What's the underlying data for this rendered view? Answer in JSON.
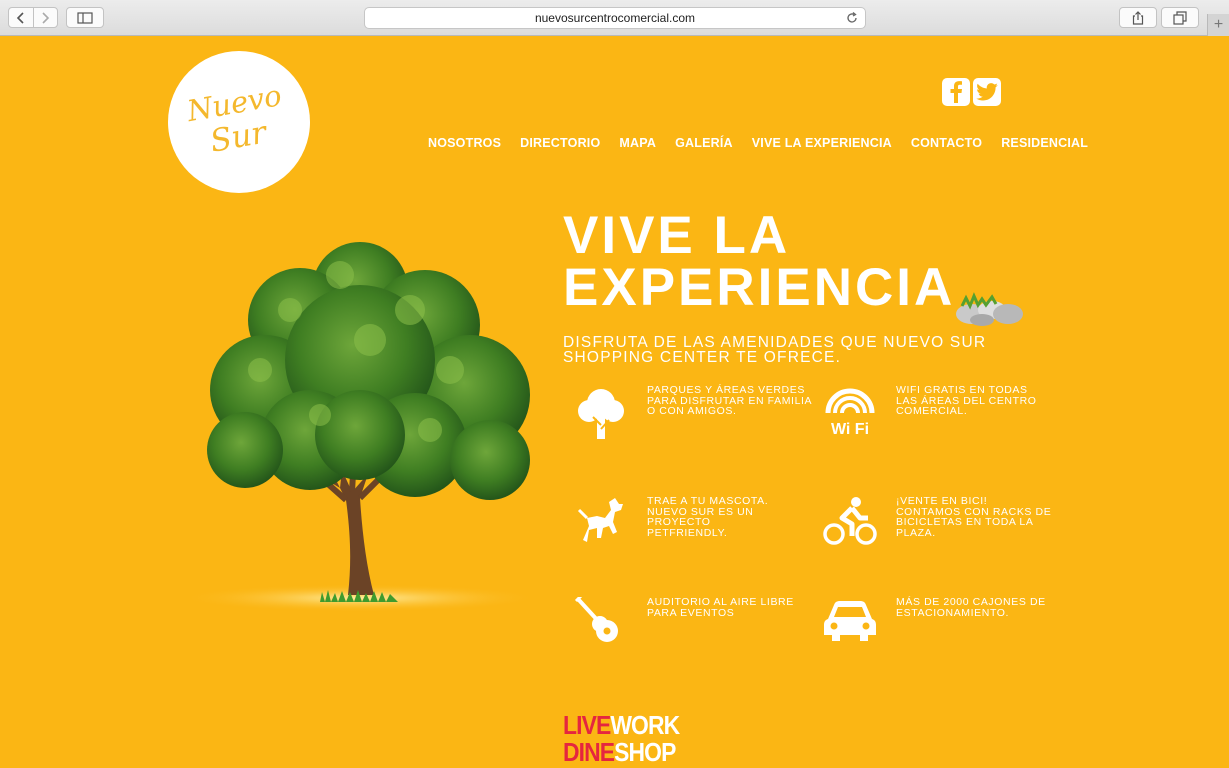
{
  "browser": {
    "url": "nuevosurcentrocomercial.com",
    "newtab_label": "+"
  },
  "brand": {
    "logo_line1": "Nuevo",
    "logo_line2": "Sur"
  },
  "social": [
    "facebook-icon",
    "twitter-icon"
  ],
  "nav": [
    {
      "label": "NOSOTROS"
    },
    {
      "label": "DIRECTORIO"
    },
    {
      "label": "MAPA"
    },
    {
      "label": "GALERÍA"
    },
    {
      "label": "VIVE LA EXPERIENCIA"
    },
    {
      "label": "CONTACTO"
    },
    {
      "label": "RESIDENCIAL"
    }
  ],
  "hero": {
    "title_line1": "VIVE LA",
    "title_line2": "EXPERIENCIA",
    "subtitle": "DISFRUTA DE LAS AMENIDADES QUE NUEVO SUR SHOPPING CENTER TE OFRECE."
  },
  "features": [
    {
      "icon": "tree-icon",
      "text": "PARQUES Y ÁREAS VERDES\nPARA DISFRUTAR EN FAMILIA\nO CON AMIGOS."
    },
    {
      "icon": "wifi-icon",
      "text": "WIFI GRATIS EN TODAS\nLAS ÁREAS DEL CENTRO\nCOMERCIAL.",
      "icon_text": "Wi Fi"
    },
    {
      "icon": "dog-icon",
      "text": "TRAE A TU MASCOTA.\nNUEVO SUR ES UN PROYECTO\nPETFRIENDLY."
    },
    {
      "icon": "bicycle-icon",
      "text": "¡VENTE EN BICI!\nCONTAMOS CON RACKS DE\nBICICLETAS EN TODA LA\nPLAZA."
    },
    {
      "icon": "guitar-icon",
      "text": "AUDITORIO AL AIRE LIBRE\nPARA EVENTOS"
    },
    {
      "icon": "car-icon",
      "text": "MÁS DE 2000 CAJONES DE\nESTACIONAMIENTO."
    }
  ],
  "tagline": {
    "live": "LIVE",
    "work": "WORK",
    "dine": "DINE",
    "shop": "SHOP"
  },
  "colors": {
    "background": "#fbb614",
    "tagline_red": "#e5263f",
    "tree_green": "#3f7e22"
  }
}
